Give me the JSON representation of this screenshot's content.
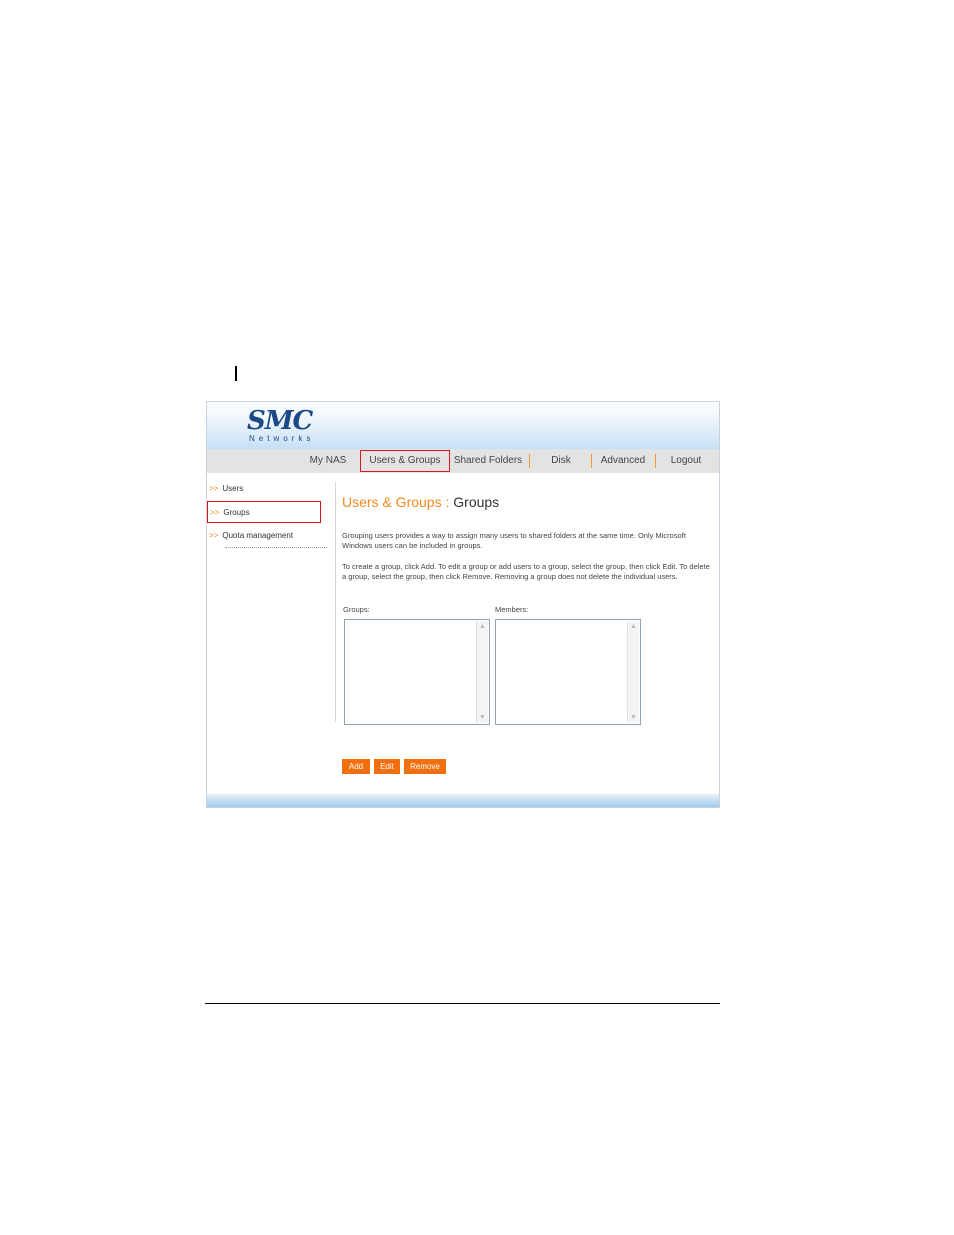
{
  "logo": {
    "main": "SMC",
    "sub": "Networks"
  },
  "nav": {
    "items": [
      {
        "label": "My NAS"
      },
      {
        "label": "Users & Groups",
        "active": true
      },
      {
        "label": "Shared Folders"
      },
      {
        "label": "Disk"
      },
      {
        "label": "Advanced"
      },
      {
        "label": "Logout"
      }
    ]
  },
  "sidebar": {
    "arrow": ">>",
    "items": [
      {
        "label": "Users"
      },
      {
        "label": "Groups",
        "active": true
      },
      {
        "label": "Quota management"
      }
    ]
  },
  "main": {
    "title_section": "Users & Groups :",
    "title_page": "Groups",
    "intro": "Grouping users provides a way to assign many users to shared folders at the same time. Only Microsoft Windows users can be included in groups.",
    "instructions": "To create a group, click Add. To edit a group or add users to a group, select the group, then click Edit. To delete a group, select the group, then click Remove. Removing a group does not delete the individual users.",
    "groups_label": "Groups:",
    "members_label": "Members:"
  },
  "buttons": {
    "add": "Add",
    "edit": "Edit",
    "remove": "Remove"
  },
  "colors": {
    "accent": "#f26f0f",
    "highlight": "#e0141e",
    "brand": "#1b4a86"
  }
}
